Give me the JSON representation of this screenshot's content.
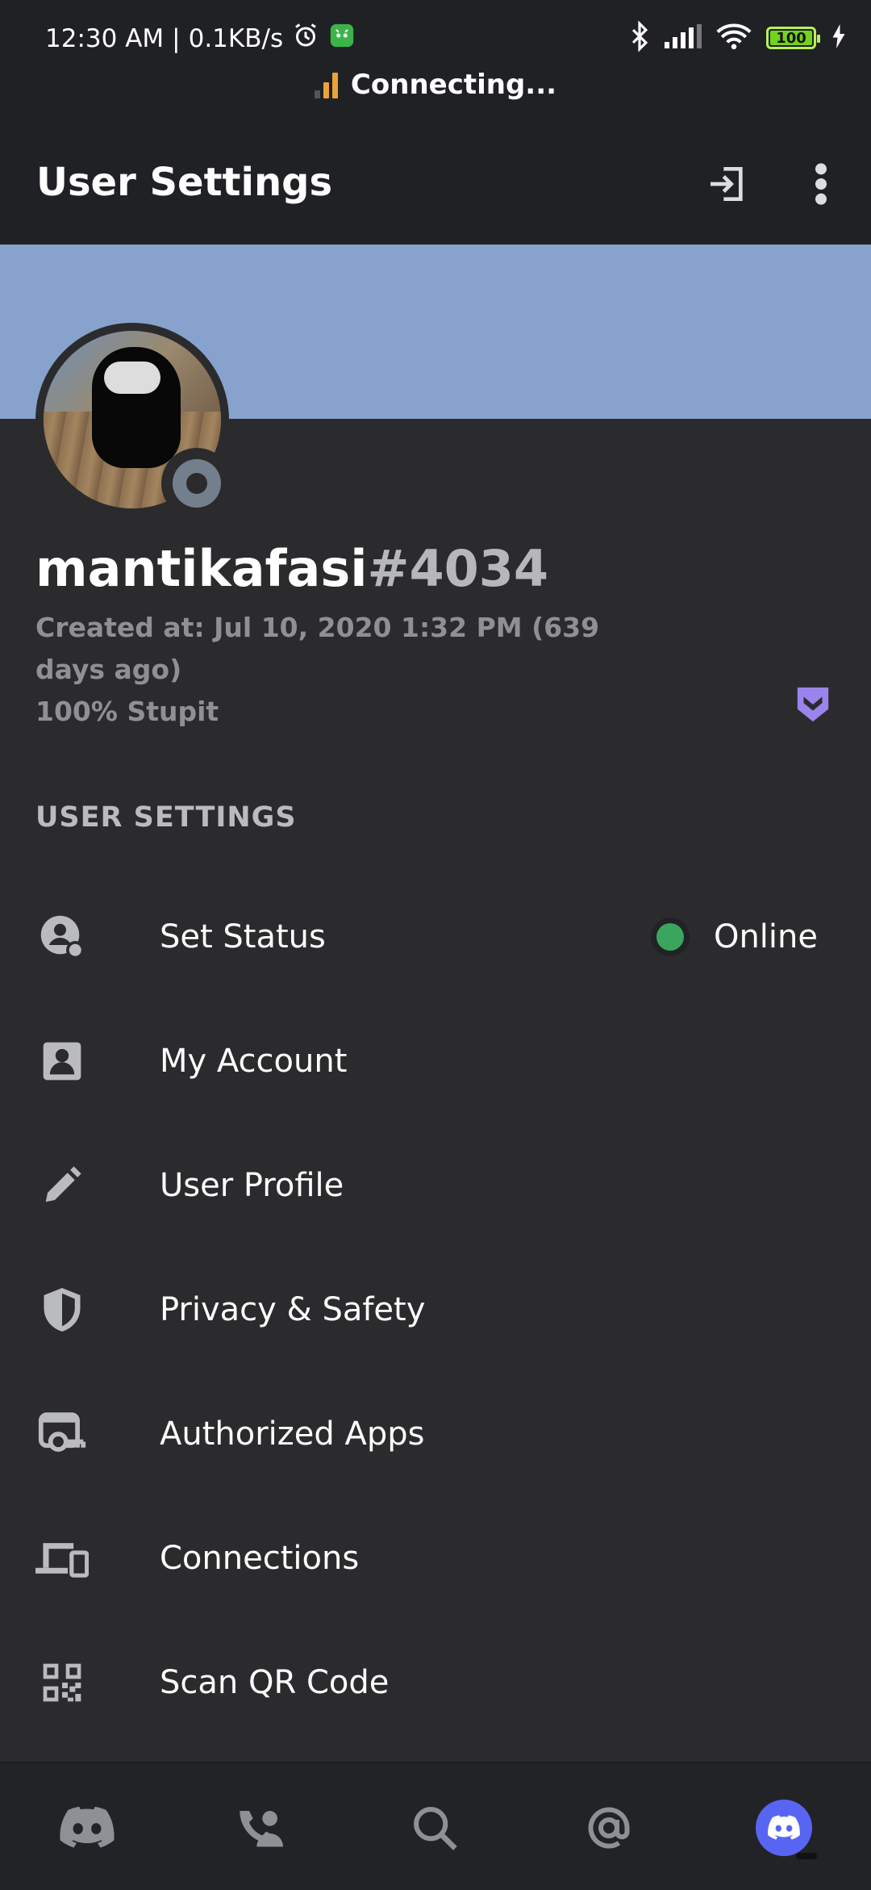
{
  "status_bar": {
    "time": "12:30 AM",
    "separator": "|",
    "speed": "0.1KB/s",
    "battery": "100"
  },
  "connection": {
    "text": "Connecting..."
  },
  "header": {
    "title": "User Settings"
  },
  "profile": {
    "username": "mantikafasi",
    "discriminator": "#4034",
    "created_at": "Created at: Jul 10, 2020 1:32 PM (639 days ago)",
    "bio": "100% Stupit",
    "banner_color": "#87a2cc"
  },
  "section": {
    "title": "USER SETTINGS"
  },
  "menu": {
    "items": [
      {
        "label": "Set Status",
        "icon": "status-icon",
        "value": "Online"
      },
      {
        "label": "My Account",
        "icon": "account-icon"
      },
      {
        "label": "User Profile",
        "icon": "pencil-icon"
      },
      {
        "label": "Privacy & Safety",
        "icon": "shield-icon"
      },
      {
        "label": "Authorized Apps",
        "icon": "apps-key-icon"
      },
      {
        "label": "Connections",
        "icon": "devices-icon"
      },
      {
        "label": "Scan QR Code",
        "icon": "qr-code-icon"
      }
    ]
  },
  "bottom_nav": {
    "items": [
      "discord-home-icon",
      "friends-icon",
      "search-icon",
      "mentions-icon",
      "profile-icon"
    ],
    "active": "profile-icon"
  },
  "colors": {
    "accent": "#5865f2",
    "online": "#3ba55d",
    "hypesquad": "#9b84ec"
  }
}
